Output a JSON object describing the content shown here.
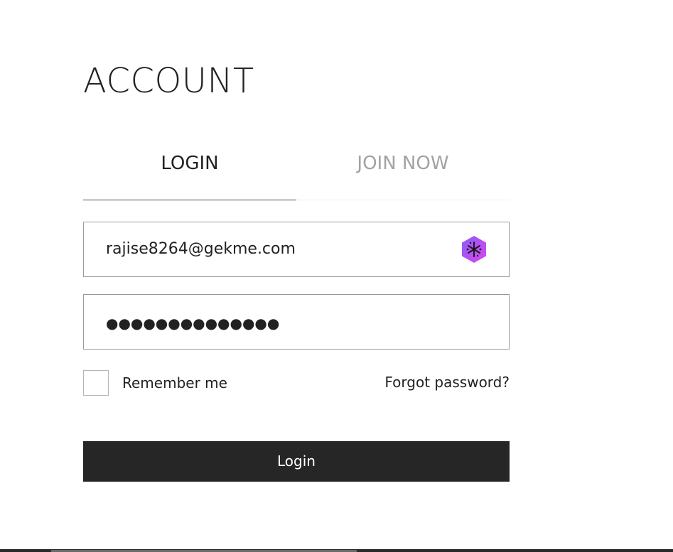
{
  "page": {
    "title": "ACCOUNT"
  },
  "tabs": [
    {
      "label": "LOGIN",
      "active": true
    },
    {
      "label": "JOIN NOW",
      "active": false
    }
  ],
  "form": {
    "email_value": "rajise8264@gekme.com",
    "password_masked": "●●●●●●●●●●●●●●",
    "remember_label": "Remember me",
    "remember_checked": false,
    "forgot_label": "Forgot password?",
    "submit_label": "Login"
  },
  "icons": {
    "email_field_extension": "password-manager-icon"
  },
  "colors": {
    "text_primary": "#222222",
    "text_inactive": "#a3a3a3",
    "button_bg": "#262626",
    "button_text": "#ffffff",
    "field_border": "#9a9a9a",
    "extension_icon": "#a855f7"
  }
}
